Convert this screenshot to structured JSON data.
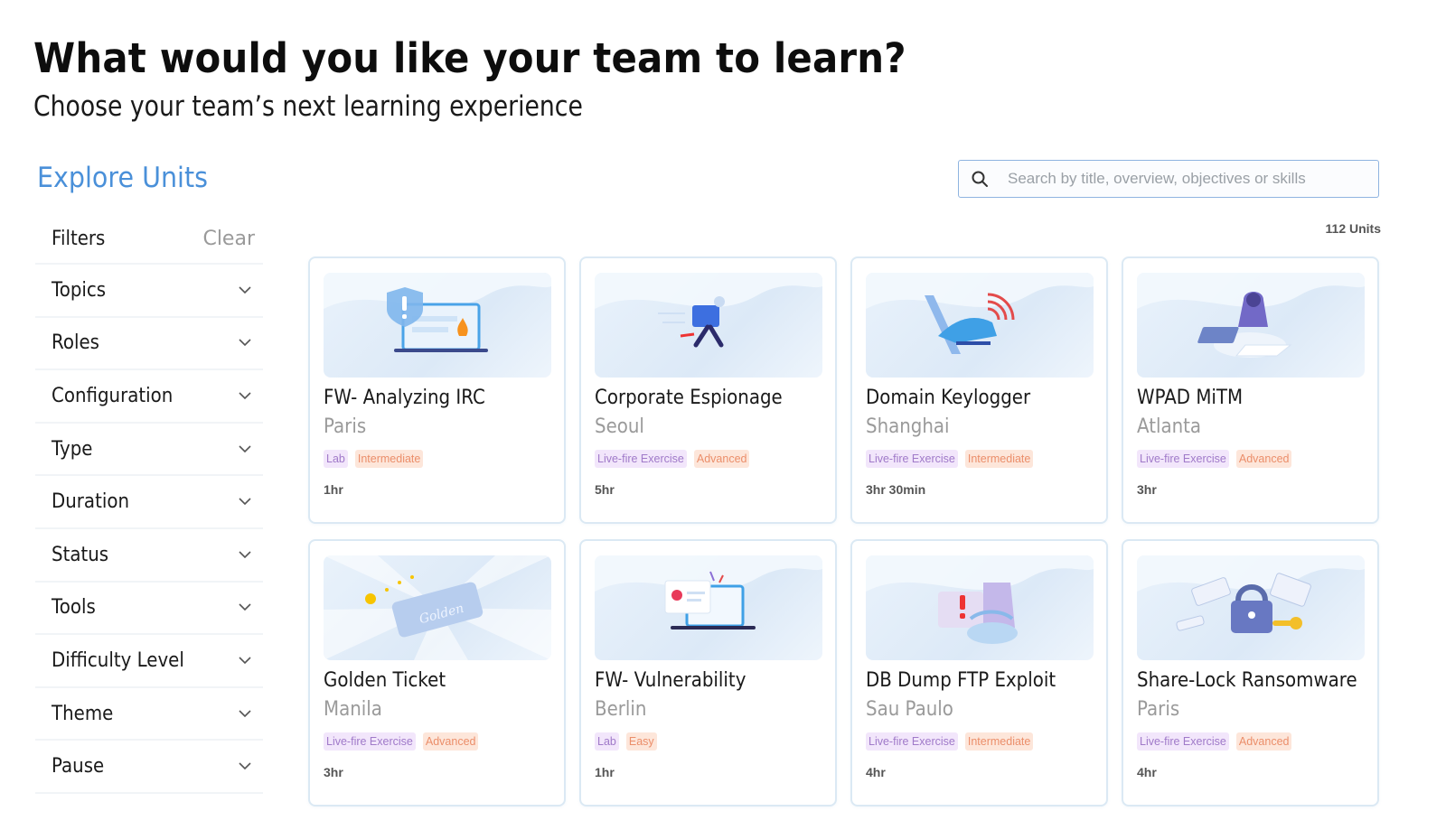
{
  "header": {
    "title": "What would you like your team to learn?",
    "subtitle": "Choose your team’s next learning experience"
  },
  "explore": {
    "title": "Explore Units"
  },
  "search": {
    "placeholder": "Search by title, overview, objectives or skills",
    "value": "",
    "icon": "search-icon"
  },
  "results": {
    "count_label": "112 Units"
  },
  "filters": {
    "label": "Filters",
    "clear_label": "Clear",
    "items": [
      {
        "label": "Topics"
      },
      {
        "label": "Roles"
      },
      {
        "label": "Configuration"
      },
      {
        "label": "Type"
      },
      {
        "label": "Duration"
      },
      {
        "label": "Status"
      },
      {
        "label": "Tools"
      },
      {
        "label": "Difficulty Level"
      },
      {
        "label": "Theme"
      },
      {
        "label": "Pause"
      }
    ]
  },
  "colors": {
    "accent": "#4a90d9",
    "type_tag_bg": "#f2e6fb",
    "type_tag_text": "#a07ac9",
    "level_tag_bg": "#fde6da",
    "level_tag_text": "#eb8e6a",
    "card_border": "#dbe9f4"
  },
  "units": [
    {
      "title": "FW- Analyzing IRC",
      "location": "Paris",
      "type": "Lab",
      "level": "Intermediate",
      "duration": "1hr",
      "illustration": "shield-laptop-fire"
    },
    {
      "title": "Corporate Espionage",
      "location": "Seoul",
      "type": "Live-fire Exercise",
      "level": "Advanced",
      "duration": "5hr",
      "illustration": "running-thief"
    },
    {
      "title": "Domain Keylogger",
      "location": "Shanghai",
      "type": "Live-fire Exercise",
      "level": "Intermediate",
      "duration": "3hr 30min",
      "illustration": "keyboard-signal"
    },
    {
      "title": "WPAD MiTM",
      "location": "Atlanta",
      "type": "Live-fire Exercise",
      "level": "Advanced",
      "duration": "3hr",
      "illustration": "hooded-hacker"
    },
    {
      "title": "Golden Ticket",
      "location": "Manila",
      "type": "Live-fire Exercise",
      "level": "Advanced",
      "duration": "3hr",
      "illustration": "golden-ticket"
    },
    {
      "title": "FW- Vulnerability",
      "location": "Berlin",
      "type": "Lab",
      "level": "Easy",
      "duration": "1hr",
      "illustration": "laptop-skull-alert"
    },
    {
      "title": "DB Dump FTP Exploit",
      "location": "Sau Paulo",
      "type": "Live-fire Exercise",
      "level": "Intermediate",
      "duration": "4hr",
      "illustration": "folder-alert"
    },
    {
      "title": "Share-Lock Ransomware",
      "location": "Paris",
      "type": "Live-fire Exercise",
      "level": "Advanced",
      "duration": "4hr",
      "illustration": "padlock-money"
    }
  ]
}
